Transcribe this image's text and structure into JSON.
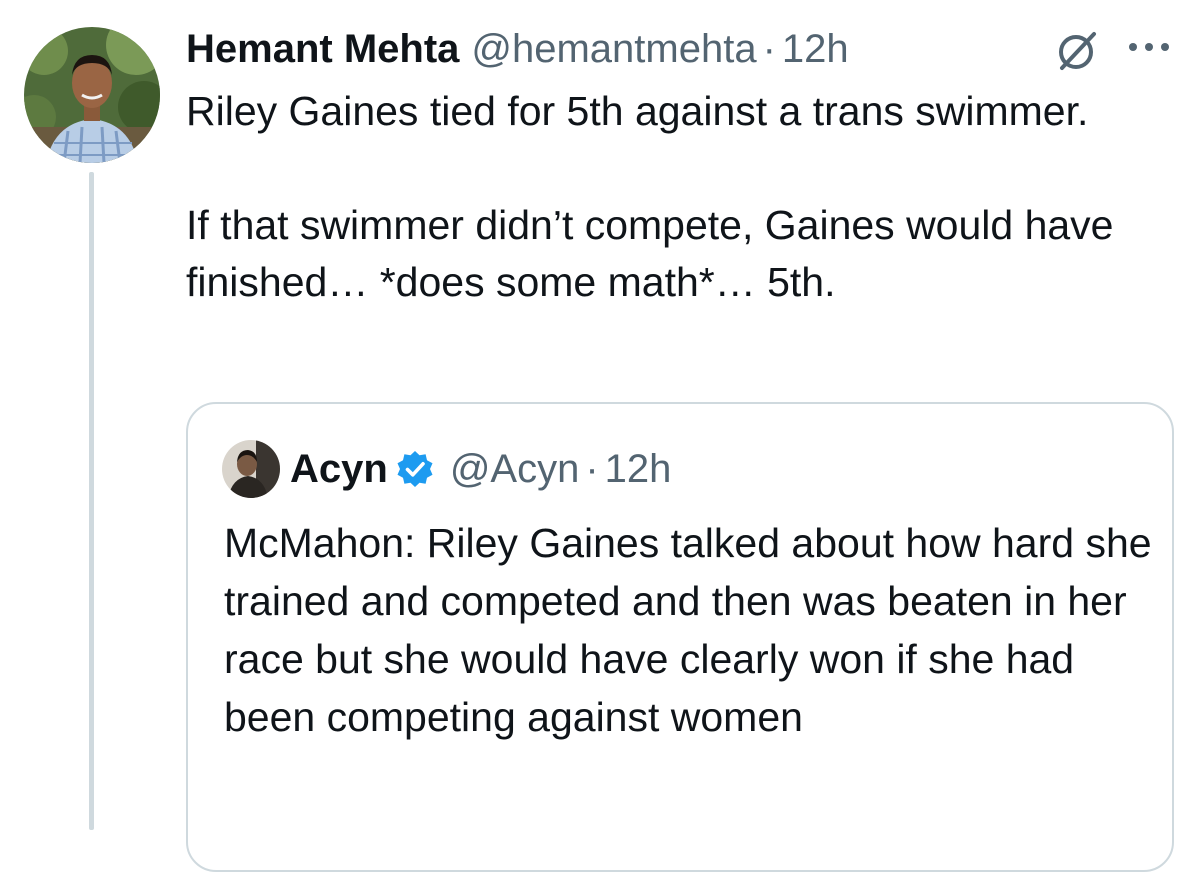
{
  "tweet": {
    "author_name": "Hemant Mehta",
    "author_handle": "@hemantmehta",
    "separator": "·",
    "time": "12h",
    "paragraphs": [
      "Riley Gaines tied for 5th against a trans swimmer.",
      "If that swimmer didn’t compete, Gaines would have finished… *does some math*… 5th."
    ],
    "actions": {
      "grok_icon": "grok-icon",
      "more_icon": "more-options-icon"
    }
  },
  "quoted_tweet": {
    "author_name": "Acyn",
    "verified": true,
    "verified_color": "#1d9bf0",
    "author_handle": "@Acyn",
    "separator": "·",
    "time": "12h",
    "text": "McMahon: Riley Gaines talked about how hard she trained and competed and then was beaten in her race but she would have clearly won if she had been competing against women"
  },
  "colors": {
    "text_primary": "#0f1419",
    "text_secondary": "#536471",
    "border": "#cfd9de",
    "accent": "#1d9bf0"
  }
}
